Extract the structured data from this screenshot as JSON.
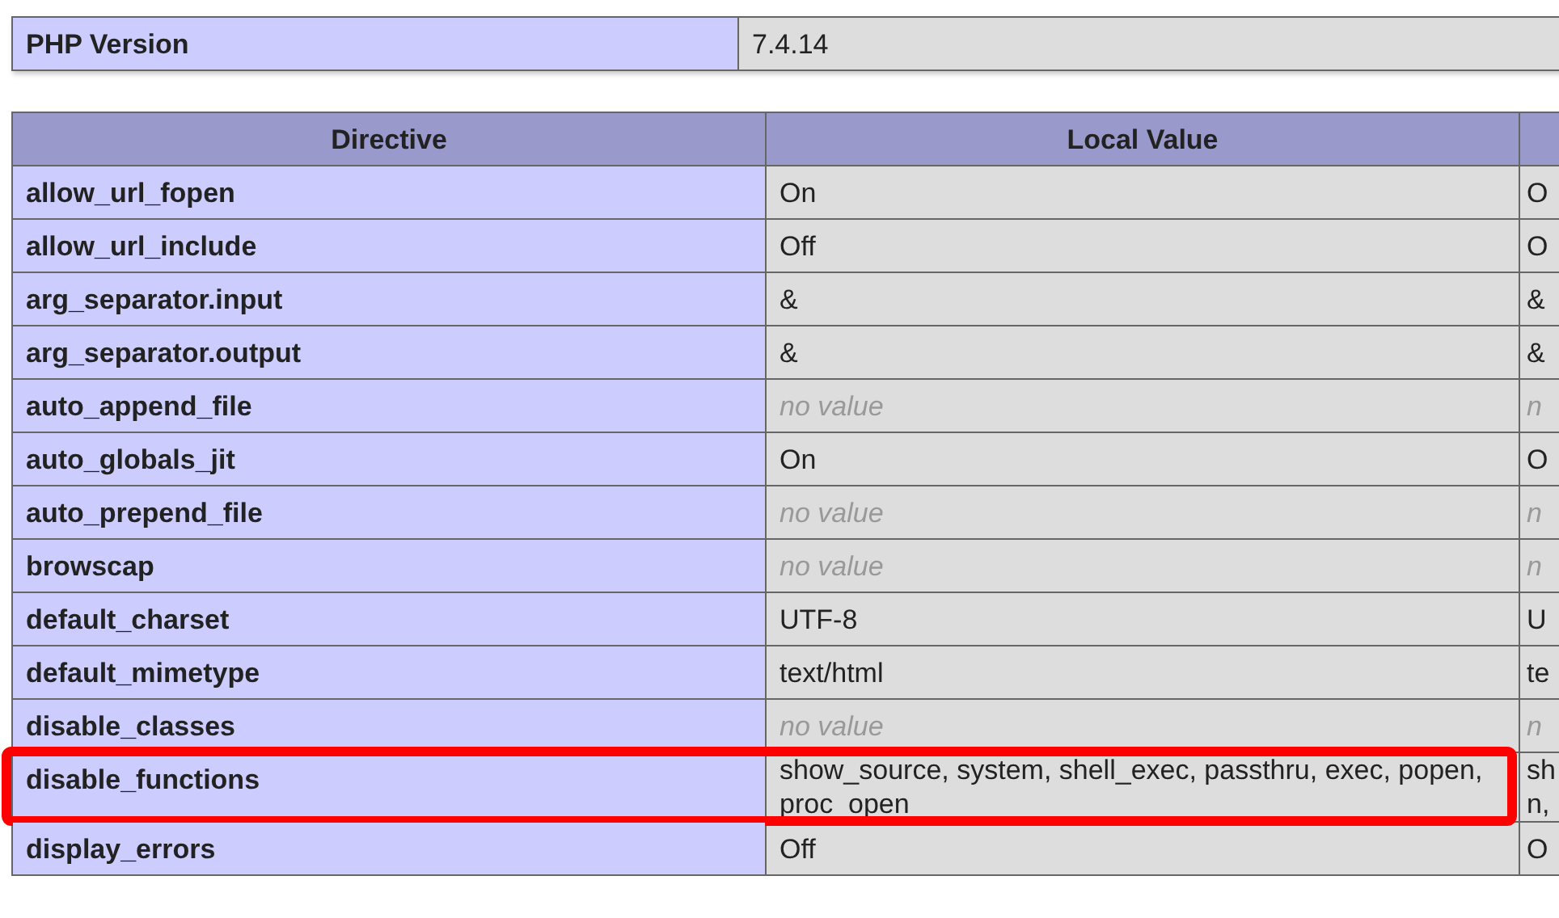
{
  "summary": {
    "label": "PHP Version",
    "value": "7.4.14"
  },
  "table": {
    "columns": [
      "Directive",
      "Local Value",
      ""
    ],
    "rows": [
      {
        "directive": "allow_url_fopen",
        "local_value": "On",
        "column_3": "O",
        "kind": "value",
        "highlighted": false
      },
      {
        "directive": "allow_url_include",
        "local_value": "Off",
        "column_3": "O",
        "kind": "value",
        "highlighted": false
      },
      {
        "directive": "arg_separator.input",
        "local_value": "&",
        "column_3": "&",
        "kind": "value",
        "highlighted": false
      },
      {
        "directive": "arg_separator.output",
        "local_value": "&",
        "column_3": "&",
        "kind": "value",
        "highlighted": false
      },
      {
        "directive": "auto_append_file",
        "local_value": "no value",
        "column_3": "n",
        "kind": "empty",
        "highlighted": false
      },
      {
        "directive": "auto_globals_jit",
        "local_value": "On",
        "column_3": "O",
        "kind": "value",
        "highlighted": false
      },
      {
        "directive": "auto_prepend_file",
        "local_value": "no value",
        "column_3": "n",
        "kind": "empty",
        "highlighted": false
      },
      {
        "directive": "browscap",
        "local_value": "no value",
        "column_3": "n",
        "kind": "empty",
        "highlighted": false
      },
      {
        "directive": "default_charset",
        "local_value": "UTF-8",
        "column_3": "U",
        "kind": "value",
        "highlighted": false
      },
      {
        "directive": "default_mimetype",
        "local_value": "text/html",
        "column_3": "te",
        "kind": "value",
        "highlighted": false
      },
      {
        "directive": "disable_classes",
        "local_value": "no value",
        "column_3": "n",
        "kind": "empty",
        "highlighted": false
      },
      {
        "directive": "disable_functions",
        "local_value": "show_source, system, shell_exec, passthru, exec, popen, proc_open",
        "column_3": "sh n,",
        "kind": "value",
        "highlighted": true
      },
      {
        "directive": "display_errors",
        "local_value": "Off",
        "column_3": "O",
        "kind": "value",
        "highlighted": false
      }
    ]
  }
}
